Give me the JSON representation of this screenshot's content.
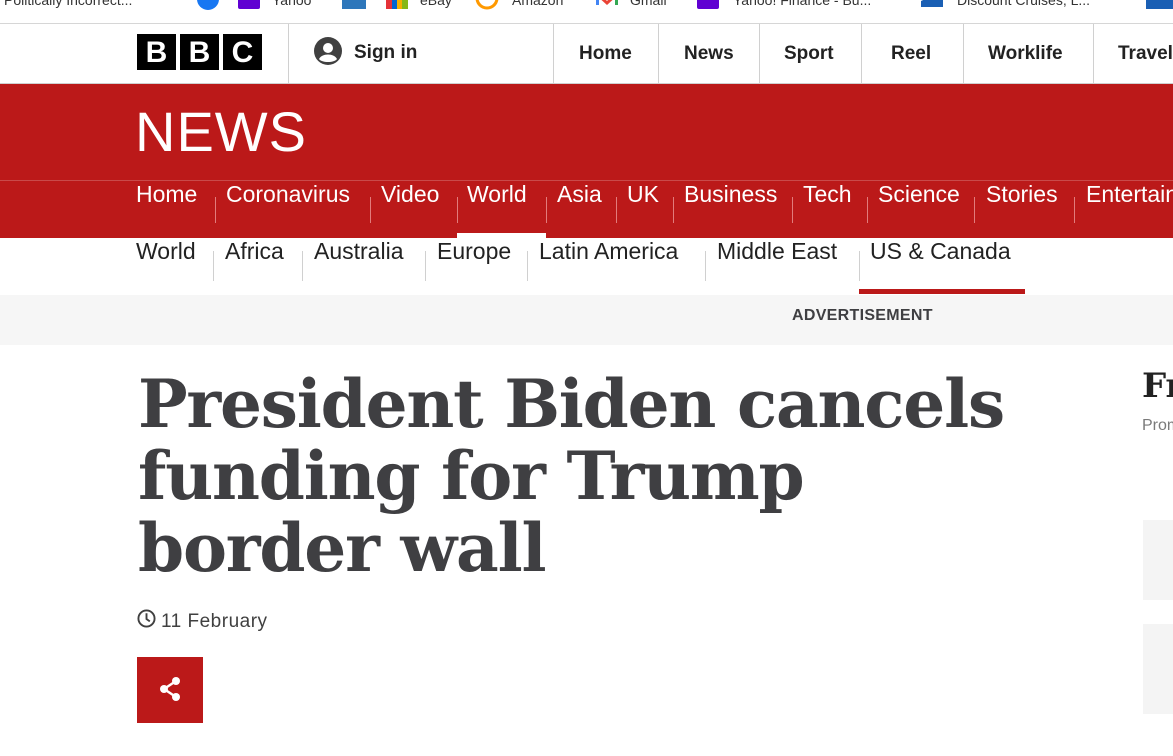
{
  "bookmarks": [
    {
      "label": "Politically Incorrect...",
      "icon": "page-icon"
    },
    {
      "label": "",
      "icon": "facebook-icon",
      "color": "#1877f2"
    },
    {
      "label": "Yahoo",
      "icon": "yahoo-icon",
      "color": "#6001d2"
    },
    {
      "label": "",
      "icon": "amex-icon",
      "color": "#2e77bb"
    },
    {
      "label": "eBay",
      "icon": "ebay-icon"
    },
    {
      "label": "Amazon",
      "icon": "amazon-icon",
      "color": "#ff9900"
    },
    {
      "label": "Gmail",
      "icon": "gmail-icon"
    },
    {
      "label": "Yahoo! Finance - Bu...",
      "icon": "yahoo-icon",
      "color": "#6001d2"
    },
    {
      "label": "Discount Cruises, L...",
      "icon": "cruise-icon",
      "color": "#1a5fb4"
    }
  ],
  "bbc": {
    "logo_letters": [
      "B",
      "B",
      "C"
    ],
    "sign_in": "Sign in",
    "top_nav": [
      "Home",
      "News",
      "Sport",
      "Reel",
      "Worklife",
      "Travel"
    ]
  },
  "news_wordmark": "NEWS",
  "main_nav": {
    "items": [
      "Home",
      "Coronavirus",
      "Video",
      "World",
      "Asia",
      "UK",
      "Business",
      "Tech",
      "Science",
      "Stories",
      "Entertainment"
    ],
    "active": "World"
  },
  "sub_nav": {
    "items": [
      "World",
      "Africa",
      "Australia",
      "Europe",
      "Latin America",
      "Middle East",
      "US & Canada"
    ],
    "active": "US & Canada"
  },
  "advert_label": "ADVERTISEMENT",
  "article": {
    "headline": "President Biden cancels funding for Trump border wall",
    "date": "11 February",
    "share_icon": "share-icon"
  },
  "right_column": {
    "title": "Fr",
    "subtitle": "Prom"
  },
  "colors": {
    "bbc_red": "#bb1919",
    "headline_text": "#3f3f42",
    "advert_bg": "#f6f6f6"
  }
}
